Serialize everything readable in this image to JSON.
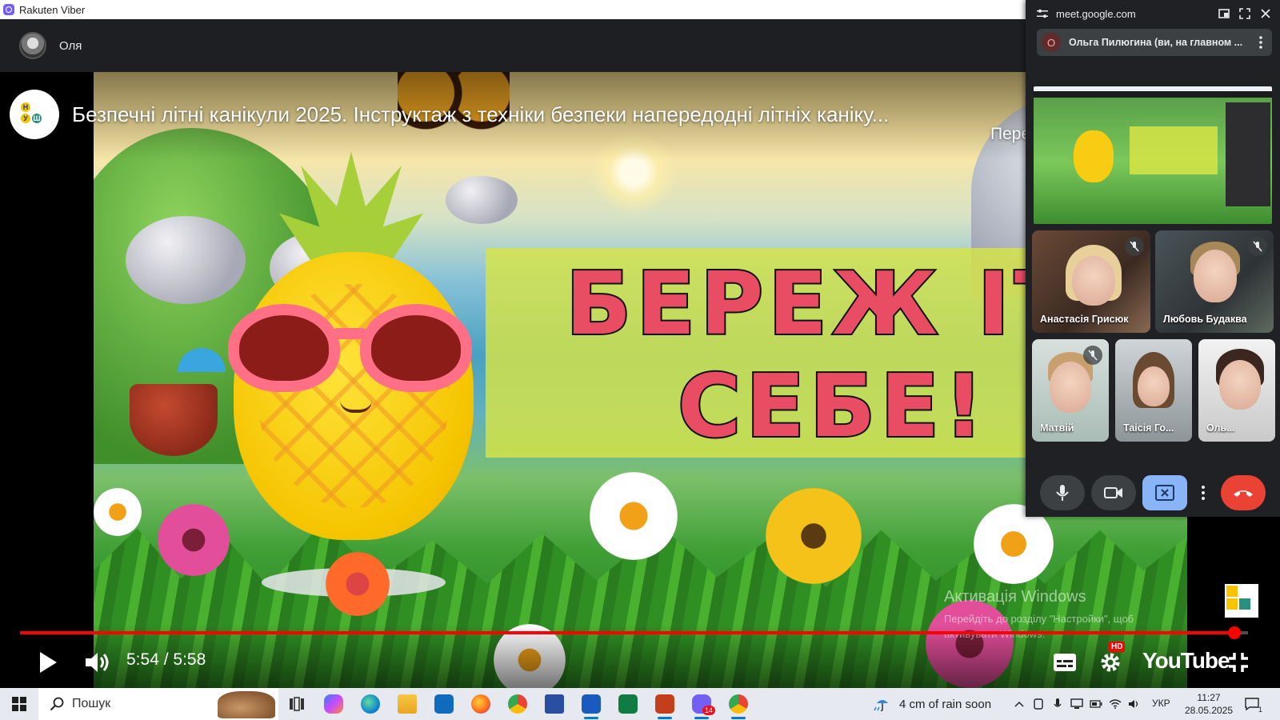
{
  "window": {
    "app_title": "Rakuten Viber"
  },
  "chat": {
    "contact_name": "Оля"
  },
  "video": {
    "title": "Безпечні літні канікули 2025. Інструктаж з техніки безпеки напередодні літніх каніку...",
    "share_label": "Пере",
    "banner_line1": "БЕРЕЖ ІТЕ",
    "banner_line2": "СЕБЕ!",
    "channel_tiles": [
      "Н",
      "У",
      "Ш"
    ],
    "time_current": "5:54",
    "time_total": "5:58",
    "time_separator": " / ",
    "progress": 0.989,
    "hd_badge": "HD",
    "youtube_logo": "YouTube",
    "watermark_title": "Активація Windows",
    "watermark_body": "Перейдіть до розділу \"Настройки\", щоб активувати Windows."
  },
  "meet": {
    "url": "meet.google.com",
    "presenter_initial": "О",
    "presenter_label": "Ольга Пилюгина (ви, на главном ...",
    "participants": [
      {
        "name": "Анастасія Грисюк",
        "muted": true
      },
      {
        "name": "Любовь Будаква",
        "muted": true
      },
      {
        "name": "Матвій",
        "muted": true
      },
      {
        "name": "Таісія Го...",
        "muted": false
      },
      {
        "name": "Оль...",
        "muted": false
      }
    ]
  },
  "taskbar": {
    "search_placeholder": "Пошук",
    "weather": "4 cm of rain soon",
    "language": "УКР",
    "time": "11:27",
    "date": "28.05.2025",
    "viber_badge": "14",
    "notification_count": "1"
  },
  "colors": {
    "youtube_red": "#ff0000",
    "banner_text": "#e94d64",
    "banner_bg": "#d7e446",
    "meet_leave": "#ea4335",
    "meet_present": "#8ab4f8"
  }
}
